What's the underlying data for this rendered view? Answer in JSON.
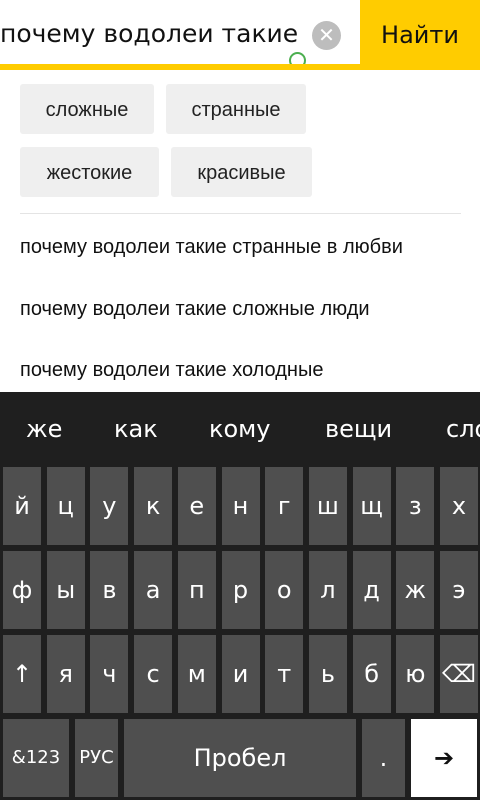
{
  "search": {
    "query": "почему водолеи такие",
    "clear_icon": "close-circle-icon",
    "button_label": "Найти"
  },
  "chips": [
    "сложные",
    "странные",
    "жестокие",
    "красивые"
  ],
  "suggestions": [
    "почему водолеи такие странные в любви",
    "почему водолеи такие сложные люди",
    "почему водолеи такие холодные"
  ],
  "keyboard": {
    "predictions": [
      "же",
      "как",
      "кому",
      "вещи",
      "сло"
    ],
    "row1": [
      "й",
      "ц",
      "у",
      "к",
      "е",
      "н",
      "г",
      "ш",
      "щ",
      "з",
      "х"
    ],
    "row2": [
      "ф",
      "ы",
      "в",
      "а",
      "п",
      "р",
      "о",
      "л",
      "д",
      "ж",
      "э"
    ],
    "row3": [
      "с",
      "ч",
      "с",
      "м",
      "и",
      "т",
      "ь",
      "б",
      "ю"
    ],
    "row3_letters": [
      "я",
      "ч",
      "с",
      "м",
      "и",
      "т",
      "ь",
      "б",
      "ю"
    ],
    "shift_icon": "shift-arrow-icon",
    "backspace_icon": "backspace-icon",
    "numbers_label": "&123",
    "lang_label": "РУС",
    "space_label": "Пробел",
    "period_label": ".",
    "enter_icon": "enter-arrow-icon"
  },
  "colors": {
    "accent": "#ffcc00",
    "keyboard_bg": "#1f1f1f",
    "key_bg": "#4f4f4f",
    "chip_bg": "#efefef"
  }
}
